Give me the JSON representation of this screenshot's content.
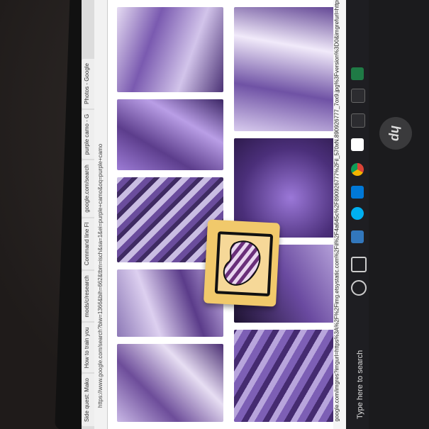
{
  "browser": {
    "tabs": [
      "Side quest: Mako",
      "How to train you",
      "mods/c/research",
      "Command line Fl",
      "google.com/search",
      "purple camo - G",
      "Photos - Google"
    ],
    "address_url": "https://www.google.com/search?biw=1366&bih=662&tbm=isch&sa=1&ei=purple+camo&oq=purple+camo"
  },
  "image_url_strip": "google.com/imgres?imgurl=https%3A%2F%2Fimg.etsystatic.com%2Fil%2F4a645c%2F890926777%2Fil_570xN.890926777_7ox9.jpg%3Fversion%3D0&imgrefurl=https%3",
  "taskbar": {
    "search_placeholder": "Type here to search"
  },
  "laptop_brand": "hp",
  "colors": {
    "accent_purple": "#7a4fb0",
    "sticker_yellow": "#f1c96b",
    "taskbar": "#1e1e22"
  }
}
